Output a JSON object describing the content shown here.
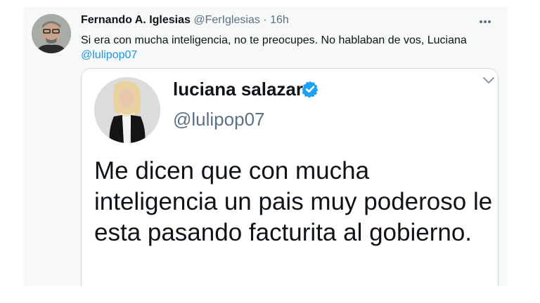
{
  "tweet": {
    "author_name": "Fernando A. Iglesias",
    "handle": "@FerIglesias",
    "separator": "·",
    "time": "16h",
    "text_prefix": "Si era con mucha inteligencia, no te preocupes. No hablaban de vos, Luciana ",
    "mention": "@lulipop07"
  },
  "quoted": {
    "name": "luciana salazar",
    "handle": "@lulipop07",
    "text": "Me dicen que con mucha inteligencia un pais muy poderoso le esta pasando facturita al gobierno."
  },
  "icons": {
    "more": "more-dots-icon",
    "verified": "verified-badge-icon",
    "chevron": "chevron-down-icon"
  },
  "colors": {
    "accent": "#1b95e0",
    "verified": "#1da1f2",
    "secondary_text": "#5b7083",
    "card_bg": "#f7f9f9"
  }
}
